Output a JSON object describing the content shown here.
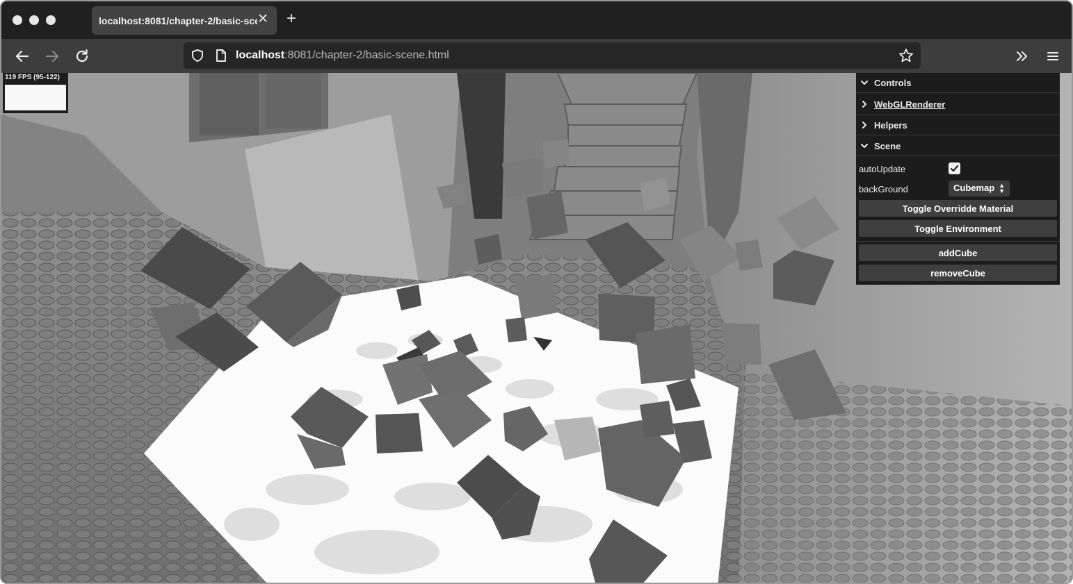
{
  "browser": {
    "tab_title": "localhost:8081/chapter-2/basic-sce",
    "tab_close": "✕",
    "new_tab": "+",
    "url_host": "localhost",
    "url_rest": ":8081/chapter-2/basic-scene.html"
  },
  "stats": {
    "fps_text": "119 FPS (95-122)"
  },
  "gui": {
    "folders": {
      "controls": "Controls",
      "webgl": "WebGLRenderer",
      "helpers": "Helpers",
      "scene": "Scene"
    },
    "auto_update_label": "autoUpdate",
    "auto_update_checked": true,
    "background_label": "backGround",
    "background_value": "Cubemap",
    "buttons": {
      "toggle_override": "Toggle Overridde Material",
      "toggle_environment": "Toggle Environment",
      "add_cube": "addCube",
      "remove_cube": "removeCube"
    }
  },
  "colors": {
    "tab_bar": "#202020",
    "nav_bar": "#3d3d3d",
    "gui_panel": "#1c1c1c",
    "floor": "#fbfbfb"
  },
  "icons": {
    "back": "arrow-left-icon",
    "forward": "arrow-right-icon",
    "reload": "reload-icon",
    "shield": "shield-icon",
    "page": "page-icon",
    "bookmark": "star-icon",
    "overflow": "double-chevron-icon",
    "menu": "hamburger-menu-icon"
  }
}
